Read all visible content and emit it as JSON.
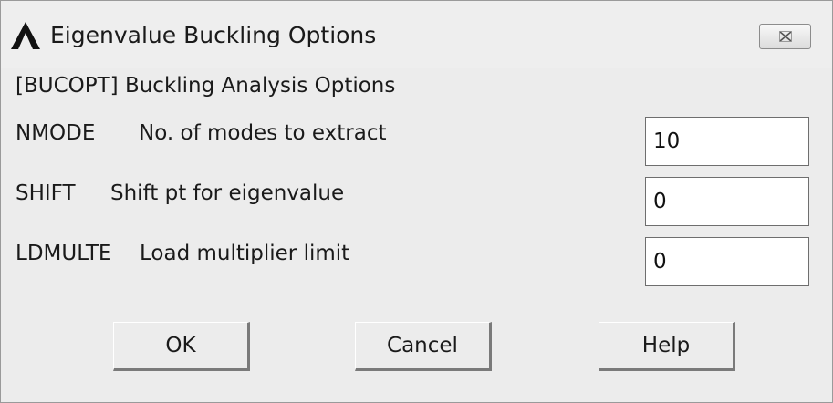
{
  "window": {
    "title": "Eigenvalue Buckling Options",
    "icon": "ansys-logo-icon",
    "close_icon": "close-icon"
  },
  "section": {
    "label": "[BUCOPT]  Buckling Analysis Options"
  },
  "rows": [
    {
      "keyword": "NMODE",
      "description": "No. of modes to extract",
      "value": "10"
    },
    {
      "keyword": "SHIFT",
      "description": "Shift pt for eigenvalue",
      "value": "0"
    },
    {
      "keyword": "LDMULTE",
      "description": "Load multiplier limit",
      "value": "0"
    }
  ],
  "buttons": {
    "ok": "OK",
    "cancel": "Cancel",
    "help": "Help"
  }
}
